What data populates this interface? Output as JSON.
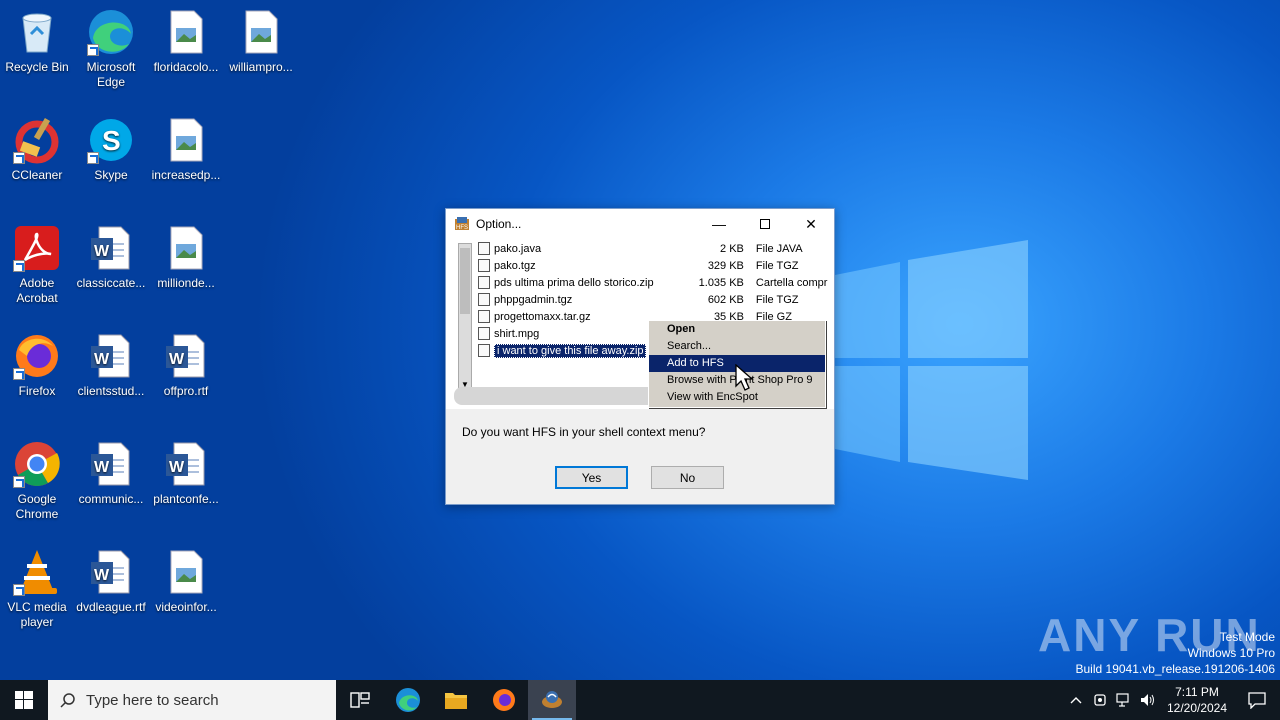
{
  "desktop": {
    "icons": [
      {
        "label": "Recycle Bin",
        "icon": "recycle-bin-icon"
      },
      {
        "label": "Microsoft Edge",
        "icon": "edge-icon"
      },
      {
        "label": "floridacolo...",
        "icon": "image-file-icon"
      },
      {
        "label": "williampro...",
        "icon": "image-file-icon"
      },
      {
        "label": "CCleaner",
        "icon": "ccleaner-icon"
      },
      {
        "label": "Skype",
        "icon": "skype-icon"
      },
      {
        "label": "increasedp...",
        "icon": "image-file-icon"
      },
      {
        "label": "Adobe Acrobat",
        "icon": "acrobat-icon"
      },
      {
        "label": "classiccate...",
        "icon": "word-doc-icon"
      },
      {
        "label": "millionde...",
        "icon": "image-file-icon"
      },
      {
        "label": "Firefox",
        "icon": "firefox-icon"
      },
      {
        "label": "clientsstud...",
        "icon": "word-doc-icon"
      },
      {
        "label": "offpro.rtf",
        "icon": "word-doc-icon"
      },
      {
        "label": "Google Chrome",
        "icon": "chrome-icon"
      },
      {
        "label": "communic...",
        "icon": "word-doc-icon"
      },
      {
        "label": "plantconfe...",
        "icon": "word-doc-icon"
      },
      {
        "label": "VLC media player",
        "icon": "vlc-icon"
      },
      {
        "label": "dvdleague.rtf",
        "icon": "word-doc-icon"
      },
      {
        "label": "videoinfor...",
        "icon": "image-file-icon"
      }
    ]
  },
  "dialog": {
    "title": "Option...",
    "files": [
      {
        "name": "pako.java",
        "size": "2 KB",
        "type": "File JAVA"
      },
      {
        "name": "pako.tgz",
        "size": "329 KB",
        "type": "File TGZ"
      },
      {
        "name": "pds ultima prima dello storico.zip",
        "size": "1.035 KB",
        "type": "Cartella compr"
      },
      {
        "name": "phppgadmin.tgz",
        "size": "602 KB",
        "type": "File TGZ"
      },
      {
        "name": "progettomaxx.tar.gz",
        "size": "35 KB",
        "type": "File GZ"
      },
      {
        "name": "shirt.mpg",
        "size": "",
        "type": ""
      },
      {
        "name": "i want to give this file away.zip",
        "size": "",
        "type": ""
      }
    ],
    "context_menu": [
      "Open",
      "Search...",
      "Add to HFS",
      "Browse with Paint Shop Pro 9",
      "View with EncSpot"
    ],
    "question": "Do you want HFS in your shell context menu?",
    "yes_label": "Yes",
    "no_label": "No"
  },
  "watermark": {
    "brand": "ANY RUN",
    "line1": "Test Mode",
    "line2": "Windows 10 Pro",
    "line3": "Build 19041.vb_release.191206-1406"
  },
  "taskbar": {
    "search_placeholder": "Type here to search",
    "time": "7:11 PM",
    "date": "12/20/2024"
  },
  "colors": {
    "taskbar": "#101820",
    "selection": "#0a246a",
    "accent": "#0078d7"
  }
}
